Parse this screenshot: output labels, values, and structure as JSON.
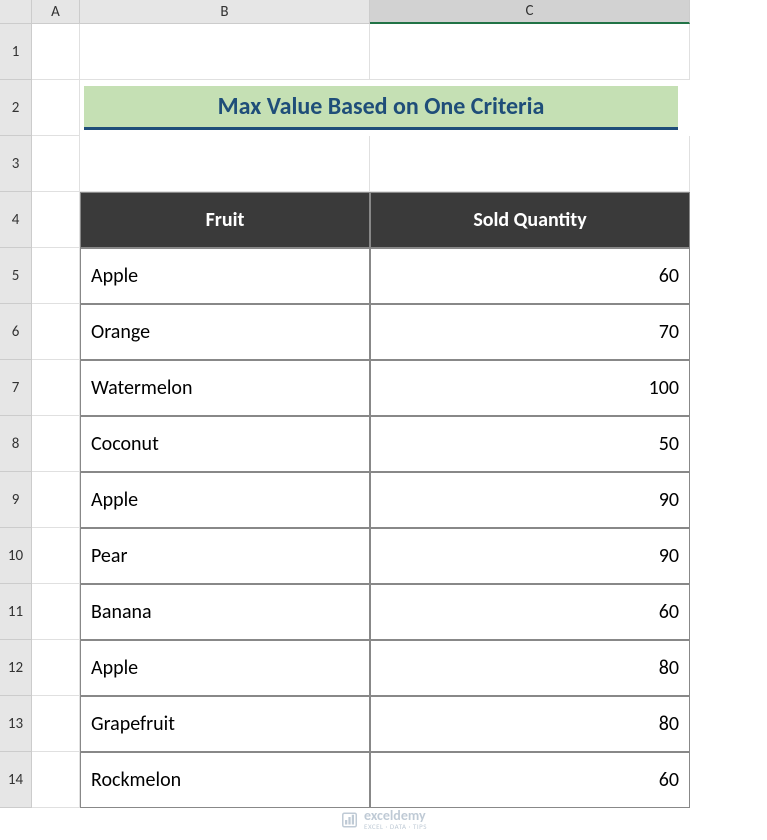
{
  "columns": {
    "A": "A",
    "B": "B",
    "C": "C"
  },
  "rows": [
    "1",
    "2",
    "3",
    "4",
    "5",
    "6",
    "7",
    "8",
    "9",
    "10",
    "11",
    "12",
    "13",
    "14"
  ],
  "selected_column": "C",
  "title": "Max Value Based on One Criteria",
  "table": {
    "headers": {
      "fruit": "Fruit",
      "sold_quantity": "Sold  Quantity"
    },
    "data": [
      {
        "fruit": "Apple",
        "qty": "60"
      },
      {
        "fruit": "Orange",
        "qty": "70"
      },
      {
        "fruit": "Watermelon",
        "qty": "100"
      },
      {
        "fruit": "Coconut",
        "qty": "50"
      },
      {
        "fruit": "Apple",
        "qty": "90"
      },
      {
        "fruit": "Pear",
        "qty": "90"
      },
      {
        "fruit": "Banana",
        "qty": "60"
      },
      {
        "fruit": "Apple",
        "qty": "80"
      },
      {
        "fruit": "Grapefruit",
        "qty": "80"
      },
      {
        "fruit": "Rockmelon",
        "qty": "60"
      }
    ]
  },
  "watermark": {
    "name": "exceldemy",
    "tagline": "EXCEL · DATA · TIPS"
  }
}
